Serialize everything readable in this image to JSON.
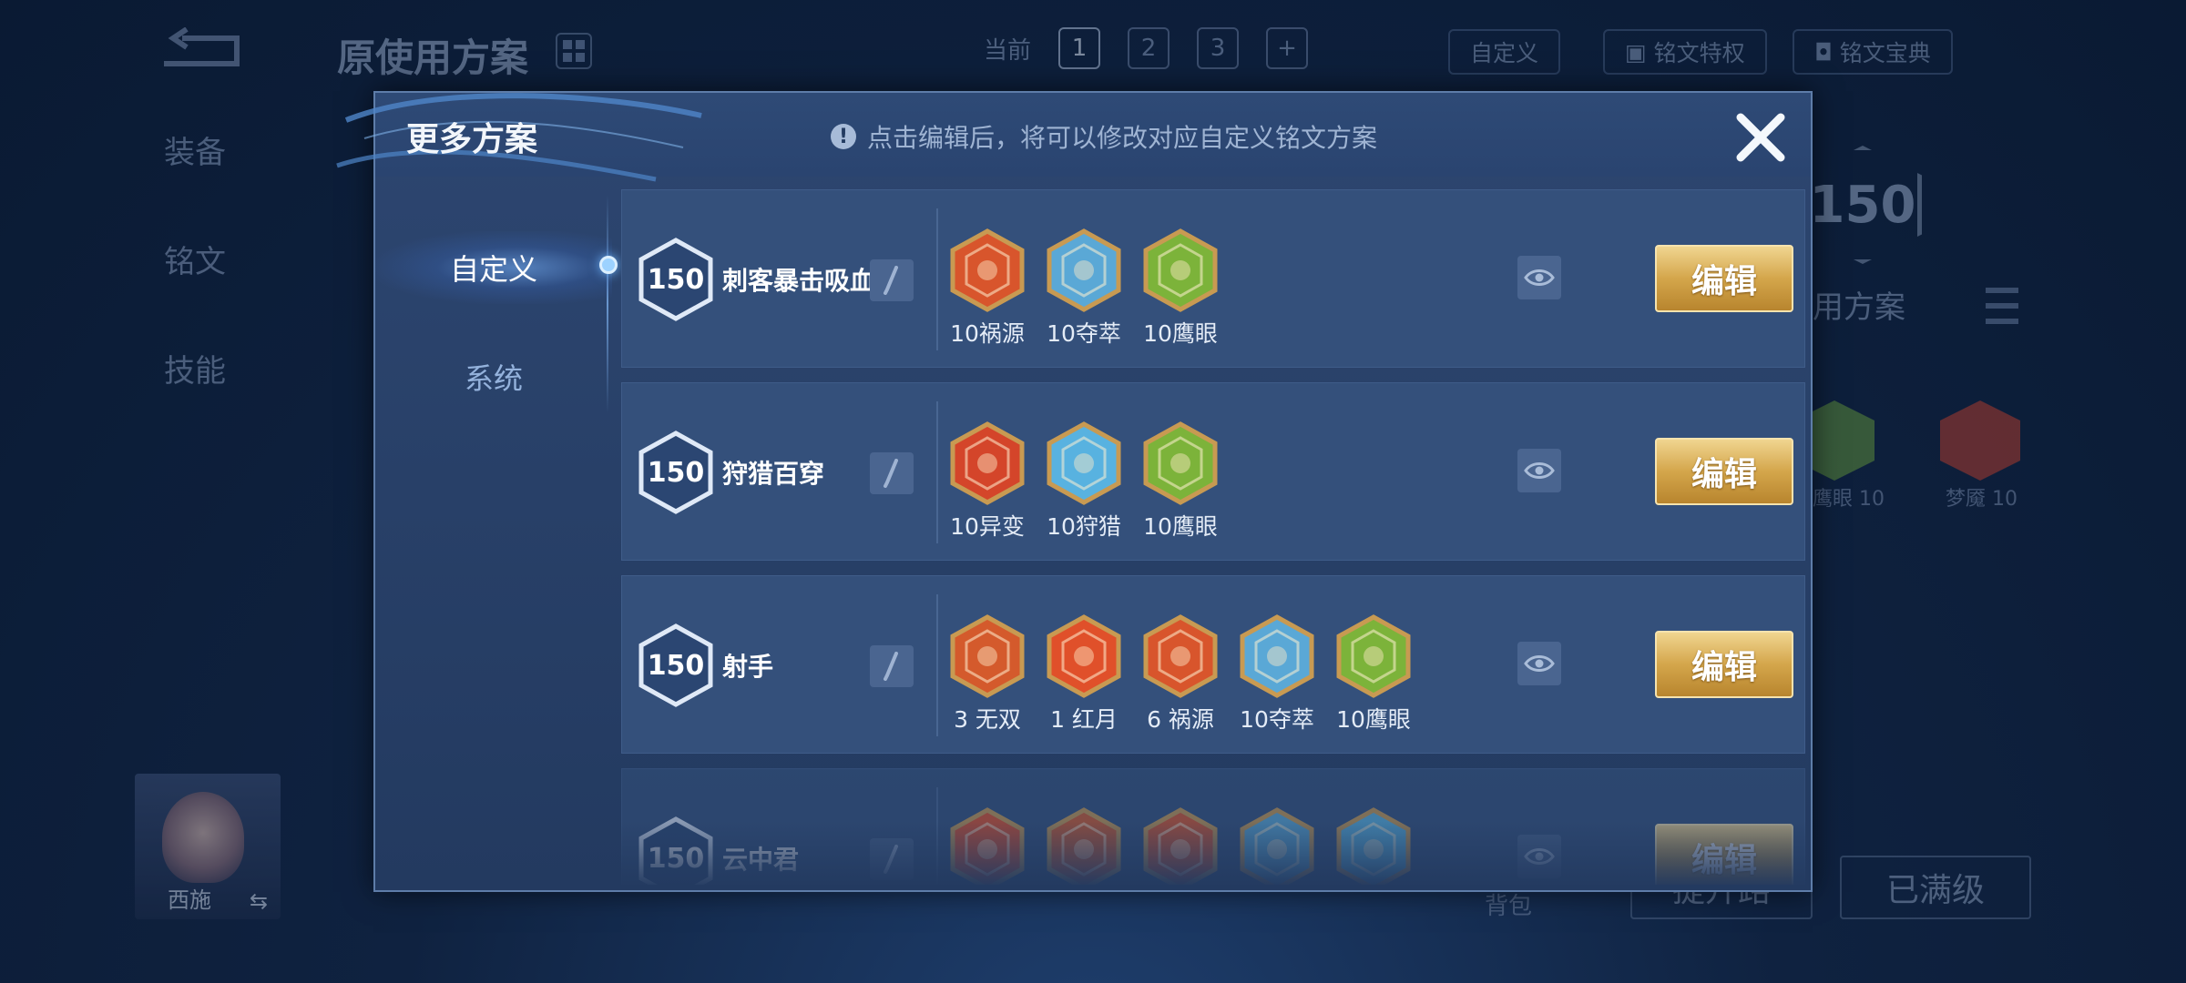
{
  "background": {
    "page_title": "原使用方案",
    "plan_tabs": {
      "current_label": "当前",
      "numbers": [
        "1",
        "2",
        "3"
      ],
      "add": "+"
    },
    "custom_button": "自定义",
    "rune_traits_button": "铭文特权",
    "rune_codex_button": "铭文宝典",
    "left_nav": [
      "装备",
      "铭文",
      "技能"
    ],
    "hero_name": "西施",
    "level_badge": "150",
    "right_label": "用方案",
    "rune_labels": [
      "鹰眼 10",
      "梦魇 10"
    ],
    "bag_label": "背包",
    "upgrade_button": "提升路",
    "maxed_button": "已满级"
  },
  "modal": {
    "title": "更多方案",
    "notice": "点击编辑后，将可以修改对应自定义铭文方案",
    "side_tabs": [
      {
        "label": "自定义",
        "active": true
      },
      {
        "label": "系统",
        "active": false
      }
    ],
    "edit_label": "编辑",
    "plans": [
      {
        "level": "150",
        "name": "刺客暴击吸血",
        "runes": [
          {
            "label": "10祸源",
            "icon": "red-claw-rune-icon",
            "color": "#d8552c"
          },
          {
            "label": "10夺萃",
            "icon": "blue-knot-rune-icon",
            "color": "#5aa8d6"
          },
          {
            "label": "10鹰眼",
            "icon": "green-clover-rune-icon",
            "color": "#7cb33a"
          }
        ]
      },
      {
        "level": "150",
        "name": "狩猎百穿",
        "runes": [
          {
            "label": "10异变",
            "icon": "red-emblem-rune-icon",
            "color": "#d4452a"
          },
          {
            "label": "10狩猎",
            "icon": "blue-lightning-rune-icon",
            "color": "#58b2e0"
          },
          {
            "label": "10鹰眼",
            "icon": "green-clover-rune-icon",
            "color": "#7cb33a"
          }
        ]
      },
      {
        "level": "150",
        "name": "射手",
        "runes": [
          {
            "label": "3 无双",
            "icon": "red-gem-rune-icon",
            "color": "#d45a2c"
          },
          {
            "label": "1 红月",
            "icon": "red-moon-rune-icon",
            "color": "#e0502a"
          },
          {
            "label": "6 祸源",
            "icon": "red-claw-rune-icon",
            "color": "#d8552c"
          },
          {
            "label": "10夺萃",
            "icon": "blue-knot-rune-icon",
            "color": "#5aa8d6"
          },
          {
            "label": "10鹰眼",
            "icon": "green-clover-rune-icon",
            "color": "#7cb33a"
          }
        ]
      },
      {
        "level": "150",
        "name": "云中君",
        "runes": [
          {
            "label": "",
            "icon": "red-moon-rune-icon",
            "color": "#e0502a"
          },
          {
            "label": "",
            "icon": "red-gem-rune-icon",
            "color": "#d45a2c"
          },
          {
            "label": "",
            "icon": "red-claw-rune-icon",
            "color": "#d8552c"
          },
          {
            "label": "",
            "icon": "blue-knot-rune-icon",
            "color": "#5aa8d6"
          },
          {
            "label": "",
            "icon": "blue-lightning-rune-icon",
            "color": "#58b2e0"
          }
        ]
      }
    ]
  }
}
